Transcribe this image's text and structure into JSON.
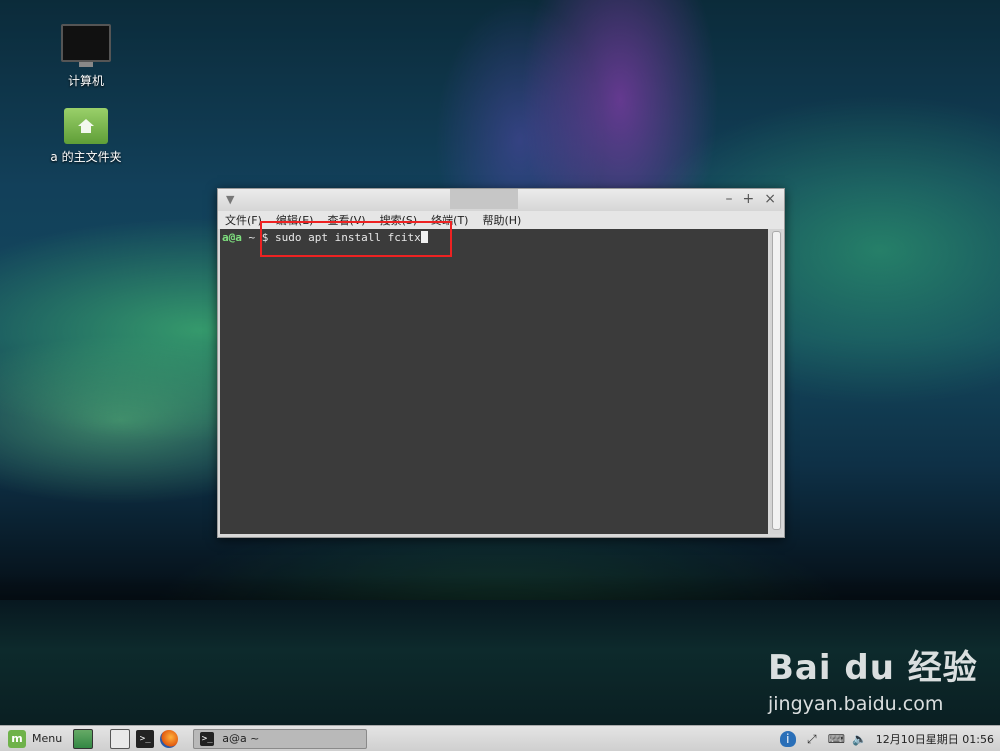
{
  "desktop": {
    "icons": [
      {
        "label": "计算机",
        "icon": "computer-icon"
      },
      {
        "label": "a 的主文件夹",
        "icon": "home-folder-icon"
      }
    ]
  },
  "terminal": {
    "menu": [
      "文件(F)",
      "编辑(E)",
      "查看(V)",
      "搜索(S)",
      "终端(T)",
      "帮助(H)"
    ],
    "window_buttons": {
      "minimize": "–",
      "maximize": "+",
      "close": "×"
    },
    "prompt_user": "a@a",
    "prompt_path": "~",
    "prompt_symbol": "$",
    "command": "sudo apt install fcitx"
  },
  "taskbar": {
    "menu_label": "Menu",
    "task_label": "a@a ~",
    "clock": "12月10日星期日  01:56"
  },
  "watermark": {
    "logo": "Bai du 经验",
    "url": "jingyan.baidu.com"
  },
  "colors": {
    "highlight": "#e22222",
    "prompt_user": "#7ee07e",
    "terminal_bg": "#3b3b3b"
  }
}
